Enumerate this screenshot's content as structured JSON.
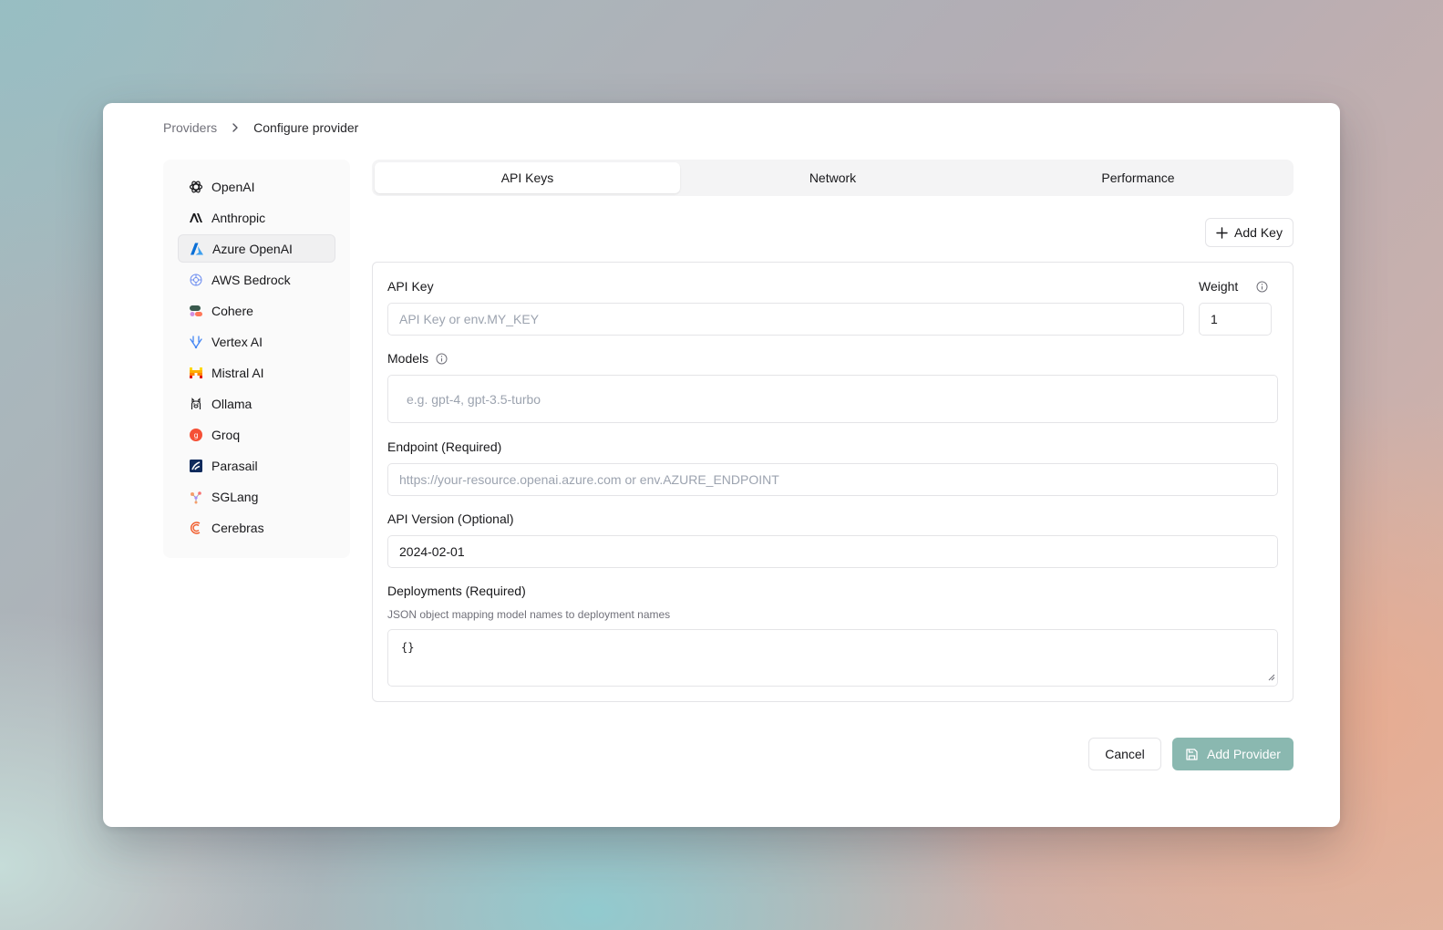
{
  "breadcrumb": {
    "parent": "Providers",
    "current": "Configure provider"
  },
  "sidebar": {
    "items": [
      {
        "label": "OpenAI",
        "icon": "openai-icon"
      },
      {
        "label": "Anthropic",
        "icon": "anthropic-icon"
      },
      {
        "label": "Azure OpenAI",
        "icon": "azure-icon",
        "active": true
      },
      {
        "label": "AWS Bedrock",
        "icon": "bedrock-icon"
      },
      {
        "label": "Cohere",
        "icon": "cohere-icon"
      },
      {
        "label": "Vertex AI",
        "icon": "vertex-icon"
      },
      {
        "label": "Mistral AI",
        "icon": "mistral-icon"
      },
      {
        "label": "Ollama",
        "icon": "ollama-icon"
      },
      {
        "label": "Groq",
        "icon": "groq-icon"
      },
      {
        "label": "Parasail",
        "icon": "parasail-icon"
      },
      {
        "label": "SGLang",
        "icon": "sglang-icon"
      },
      {
        "label": "Cerebras",
        "icon": "cerebras-icon"
      }
    ]
  },
  "tabs": [
    {
      "label": "API Keys",
      "active": true
    },
    {
      "label": "Network"
    },
    {
      "label": "Performance"
    }
  ],
  "add_key_label": "Add Key",
  "form": {
    "api_key": {
      "label": "API Key",
      "placeholder": "API Key or env.MY_KEY"
    },
    "weight": {
      "label": "Weight",
      "value": "1"
    },
    "models": {
      "label": "Models",
      "placeholder": "e.g. gpt-4, gpt-3.5-turbo"
    },
    "endpoint": {
      "label": "Endpoint (Required)",
      "placeholder": "https://your-resource.openai.azure.com or env.AZURE_ENDPOINT"
    },
    "api_version": {
      "label": "API Version (Optional)",
      "value": "2024-02-01"
    },
    "deployments": {
      "label": "Deployments (Required)",
      "hint": "JSON object mapping model names to deployment names",
      "value": "{}"
    }
  },
  "actions": {
    "cancel": "Cancel",
    "submit": "Add Provider"
  },
  "colors": {
    "primary_disabled": "#8ab8b0",
    "active_item_bg": "#f0f0f1"
  }
}
